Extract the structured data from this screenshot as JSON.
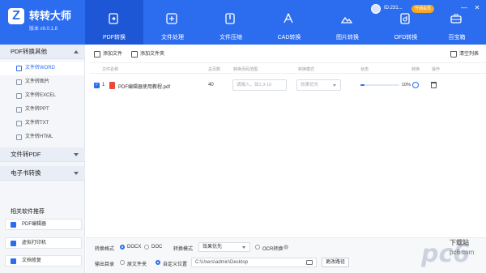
{
  "app": {
    "name": "转转大师",
    "version": "版本 v6.0.1.8"
  },
  "tabs": [
    {
      "label": "PDF转换",
      "icon": "pdf-convert-icon"
    },
    {
      "label": "文件处理",
      "icon": "file-process-icon"
    },
    {
      "label": "文件压缩",
      "icon": "compress-icon"
    },
    {
      "label": "CAD转换",
      "icon": "cad-icon"
    },
    {
      "label": "图片转换",
      "icon": "image-icon"
    },
    {
      "label": "OFD转换",
      "icon": "ofd-icon"
    },
    {
      "label": "百宝箱",
      "icon": "toolbox-icon"
    }
  ],
  "user": {
    "name": "ID:231...",
    "badge": "开通会员"
  },
  "window": {
    "minimize": "—",
    "close": "✕"
  },
  "sidebar": {
    "groups": [
      {
        "label": "PDF转换其他"
      },
      {
        "label": "文件转PDF"
      },
      {
        "label": "电子书转换"
      }
    ],
    "items": [
      {
        "label": "文件转WORD"
      },
      {
        "label": "文件转图片"
      },
      {
        "label": "文件转EXCEL"
      },
      {
        "label": "文件转PPT"
      },
      {
        "label": "文件转TXT"
      },
      {
        "label": "文件转HTML"
      }
    ],
    "recommend_title": "相关软件推荐",
    "recommend": [
      {
        "label": "PDF编辑器"
      },
      {
        "label": "虚拟打印机"
      },
      {
        "label": "文档修复"
      }
    ]
  },
  "toolbar": {
    "add_file": "添加文件",
    "add_folder": "添加文件夹",
    "clear": "清空列表"
  },
  "table": {
    "headers": {
      "name": "文件名称",
      "pages": "总页数",
      "range": "转换页码范围",
      "mode": "转换模式",
      "status": "状态",
      "action1": "转换",
      "action2": "操作"
    },
    "rows": [
      {
        "index": "1",
        "name": "PDF编辑器使用教程.pdf",
        "pages": "40",
        "range_placeholder": "请输入，如1,3-10",
        "mode": "效果优先",
        "progress": 10,
        "progress_text": "10%"
      }
    ]
  },
  "bottom": {
    "format_label": "转换格式",
    "format_docx": "DOCX",
    "format_doc": "DOC",
    "mode_label": "转换模式",
    "mode_value": "效果优先",
    "ocr_label": "OCR转换",
    "output_label": "输出目录",
    "output_original": "原文件夹",
    "output_custom": "自定义位置",
    "path": "C:\\Users\\admin\\Desktop",
    "change_path": "更改路径"
  },
  "watermark": {
    "logo": "pc6",
    "title": "下载站",
    "url": "pc6.com"
  },
  "colors": {
    "primary": "#2c6df0",
    "header": "#2c6df0",
    "active_tab": "#1e57d6",
    "badge": "#f5a623"
  }
}
